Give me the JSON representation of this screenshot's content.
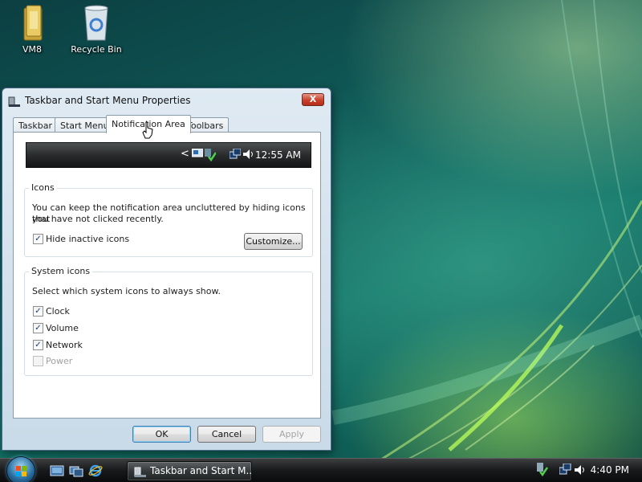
{
  "desktop": {
    "icons": [
      {
        "label": "VM8",
        "icon": "folder-icon"
      },
      {
        "label": "Recycle Bin",
        "icon": "recycle-bin-icon"
      }
    ]
  },
  "window": {
    "title": "Taskbar and Start Menu Properties",
    "close_label": "X",
    "tabs": [
      {
        "label": "Taskbar"
      },
      {
        "label": "Start Menu"
      },
      {
        "label": "Notification Area",
        "active": true
      },
      {
        "label": "Toolbars"
      }
    ],
    "preview": {
      "arrow": "<",
      "time": "12:55 AM"
    },
    "icons_group": {
      "title": "Icons",
      "description_line1": "You can keep the notification area uncluttered by hiding icons that",
      "description_line2": "you have not clicked recently.",
      "hide_inactive": {
        "label": "Hide inactive icons",
        "checked": true
      },
      "customize_label": "Customize..."
    },
    "system_icons_group": {
      "title": "System icons",
      "description": "Select which system icons to always show.",
      "options": [
        {
          "label": "Clock",
          "checked": true,
          "enabled": true
        },
        {
          "label": "Volume",
          "checked": true,
          "enabled": true
        },
        {
          "label": "Network",
          "checked": true,
          "enabled": true
        },
        {
          "label": "Power",
          "checked": false,
          "enabled": false
        }
      ]
    },
    "buttons": {
      "ok": "OK",
      "cancel": "Cancel",
      "apply": "Apply"
    }
  },
  "taskbar": {
    "task_button_label": "Taskbar and Start M...",
    "time": "4:40 PM"
  },
  "colors": {
    "accent": "#3c7fb1",
    "close_button": "#c8412c"
  }
}
